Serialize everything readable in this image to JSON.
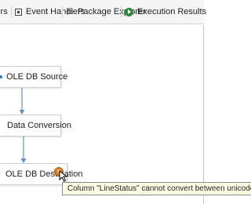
{
  "toolbar": {
    "tabs": [
      {
        "label": "lers",
        "icon": "data-flow-icon"
      },
      {
        "label": "Event Handlers",
        "icon": "event-handlers-icon"
      },
      {
        "label": "Package Explorer",
        "icon": "package-explorer-icon"
      },
      {
        "label": "Execution Results",
        "icon": "execution-results-icon"
      }
    ]
  },
  "canvas": {
    "components": [
      {
        "label": "OLE DB Source"
      },
      {
        "label": "Data Conversion"
      },
      {
        "label": "OLE DB Destination"
      }
    ],
    "error_badge": {
      "glyph": "✕",
      "color": "#e07b1f"
    },
    "tooltip": {
      "text": "Column \"LineStatus\" cannot convert between unicode"
    }
  },
  "colors": {
    "accent_blue": "#2c7cc8",
    "path_arrow": "#6b8fb5",
    "run_green": "#2e8b3a"
  }
}
